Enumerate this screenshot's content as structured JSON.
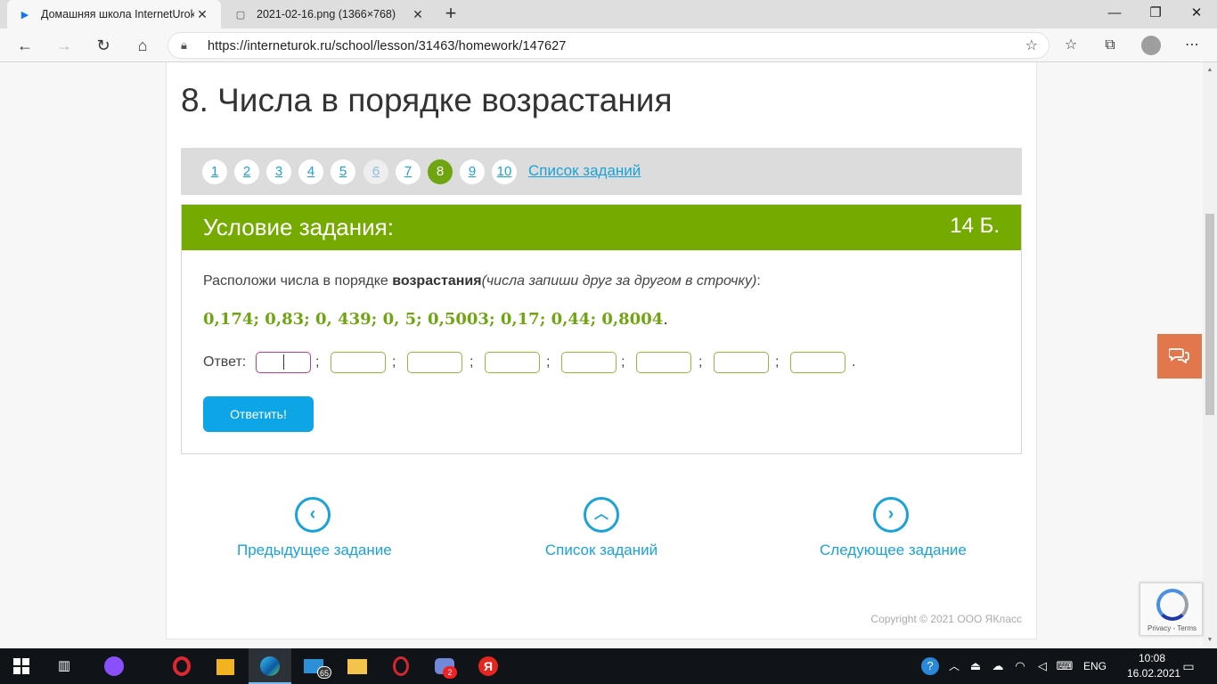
{
  "browser": {
    "tabs": [
      {
        "title": "Домашняя школа InternetUrok.r",
        "close": "✕"
      },
      {
        "title": "2021-02-16.png (1366×768)",
        "close": "✕"
      }
    ],
    "new_tab": "+",
    "window_controls": {
      "minimize": "—",
      "maximize": "❐",
      "close": "✕"
    },
    "url": "https://interneturok.ru/school/lesson/31463/homework/147627"
  },
  "page": {
    "title": "8. Числа в порядке возрастания",
    "pager": {
      "items": [
        "1",
        "2",
        "3",
        "4",
        "5",
        "6",
        "7",
        "8",
        "9",
        "10"
      ],
      "current": "8",
      "list_link": "Список заданий"
    },
    "task": {
      "header": "Условие задания:",
      "score": "14 Б.",
      "text_before": "Расположи числа в порядке ",
      "text_bold": "возрастания",
      "text_italic": "(числа запиши друг за другом в строчку)",
      "text_after": ":",
      "numbers": "0,174; 0,83; 0, 439; 0, 5; 0,5003; 0,17; 0,44; 0,8004",
      "numbers_end": ".",
      "answer_label": "Ответ:",
      "answer_values": [
        "",
        "",
        "",
        "",
        "",
        "",
        "",
        ""
      ],
      "separator": ";",
      "end_mark": ".",
      "submit": "Ответить!"
    },
    "bottom_nav": {
      "prev": "Предыдущее задание",
      "list": "Список заданий",
      "next": "Следующее задание"
    },
    "copyright": "Copyright © 2021 ООО ЯКласс",
    "recaptcha": "Privacy - Terms"
  },
  "taskbar": {
    "mail_badge": "65",
    "discord_badge": "2",
    "lang": "ENG",
    "time": "10:08",
    "date": "16.02.2021"
  },
  "colors": {
    "accent_green": "#75ab00",
    "link_blue": "#1aa3d9",
    "button_blue": "#0ea5e6",
    "chat_orange": "#e2764d"
  }
}
